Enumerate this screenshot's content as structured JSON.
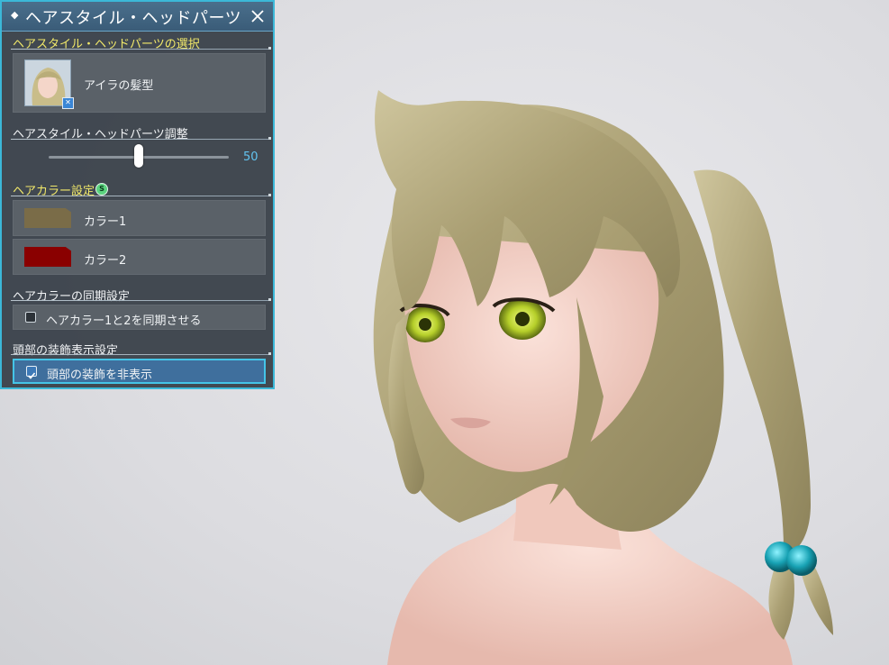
{
  "panel": {
    "title": "ヘアスタイル・ヘッドパーツ",
    "section_selection": "ヘアスタイル・ヘッドパーツの選択",
    "hairstyle_name": "アイラの髪型",
    "section_adjust": "ヘアスタイル・ヘッドパーツ調整",
    "slider": {
      "value": 50,
      "display": "50",
      "min": 0,
      "max": 100
    },
    "section_color": "ヘアカラー設定",
    "color_badge": "S",
    "color1_label": "カラー1",
    "color1_hex": "#7a6c48",
    "color2_label": "カラー2",
    "color2_hex": "#8a0000",
    "section_sync": "ヘアカラーの同期設定",
    "sync_label": "ヘアカラー1と2を同期させる",
    "sync_checked": false,
    "section_head_deco": "頭部の装飾表示設定",
    "hide_deco_label": "頭部の装飾を非表示",
    "hide_deco_checked": true
  },
  "colors": {
    "accent": "#3bb8d8",
    "section_yellow": "#f2e96a",
    "panel_bg": "#343c44",
    "hair": "#b7ad82",
    "bead": "#1aa6b6"
  },
  "icons": [
    "close-icon",
    "diamond-icon",
    "checkmark-icon"
  ]
}
